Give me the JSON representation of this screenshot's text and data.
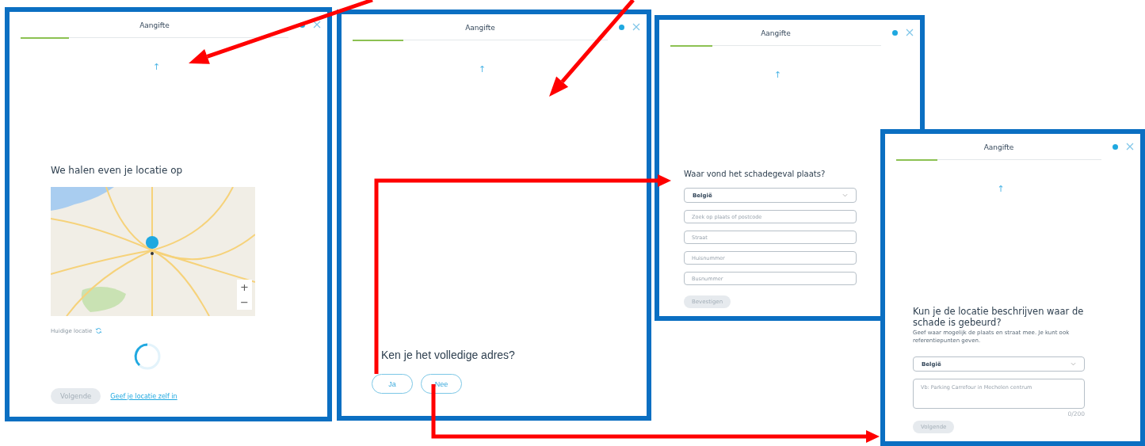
{
  "screens": [
    {
      "kind": "map",
      "title": "Aangifte",
      "progress": {
        "level": 0.18
      },
      "scroll_hint": "↑",
      "heading": "We halen even je locatie op",
      "map": {
        "zoom_buttons": [
          "+",
          "−"
        ]
      },
      "location_label": "Huidige locatie",
      "loading": true,
      "buttons": [
        {
          "label": "Volgende",
          "disabled": true
        }
      ],
      "link": "Geef je locatie zelf in"
    },
    {
      "kind": "question",
      "title": "Aangifte",
      "progress": {
        "level": 0.2
      },
      "scroll_hint": "↑",
      "heading": "Ken je het volledige adres?",
      "options": [
        {
          "label": "Ja"
        },
        {
          "label": "Nee"
        }
      ]
    },
    {
      "kind": "address_form",
      "title": "Aangifte",
      "progress": {
        "level": 0.2
      },
      "scroll_hint": "↑",
      "heading": "Waar vond het schadegeval plaats?",
      "country_select": "België",
      "fields": [
        {
          "placeholder": "Zoek op plaats of postcode"
        },
        {
          "placeholder": "Straat"
        },
        {
          "placeholder": "Huisnummer"
        },
        {
          "placeholder": "Busnummer"
        }
      ],
      "buttons": [
        {
          "label": "Bevestigen",
          "disabled": true
        }
      ]
    },
    {
      "kind": "description",
      "title": "Aangifte",
      "progress": {
        "level": 0.2
      },
      "scroll_hint": "↑",
      "heading": "Kun je de locatie beschrijven waar de schade is gebeurd?",
      "hint": "Geef waar mogelijk de plaats en straat mee. Je kunt ook referentiepunten geven.",
      "country_select": "België",
      "textarea": {
        "placeholder": "Vb: Parking Carrefour in Mechelen centrum",
        "counter": "0/200"
      },
      "buttons": [
        {
          "label": "Volgende",
          "disabled": true
        }
      ]
    }
  ]
}
